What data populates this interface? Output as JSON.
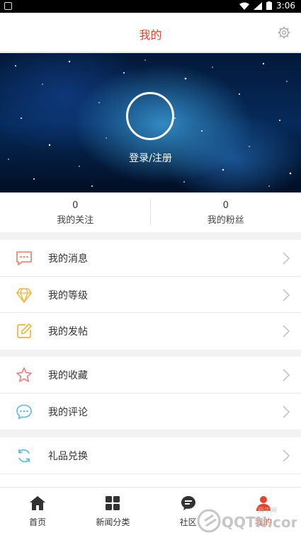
{
  "status_bar": {
    "time": "3:06"
  },
  "header": {
    "title": "我的"
  },
  "profile": {
    "login_label": "登录/注册"
  },
  "stats": [
    {
      "count": "0",
      "label": "我的关注"
    },
    {
      "count": "0",
      "label": "我的粉丝"
    }
  ],
  "menu_groups": [
    [
      {
        "label": "我的消息",
        "icon": "message-icon"
      },
      {
        "label": "我的等级",
        "icon": "diamond-icon"
      },
      {
        "label": "我的发帖",
        "icon": "edit-icon"
      }
    ],
    [
      {
        "label": "我的收藏",
        "icon": "star-icon"
      },
      {
        "label": "我的评论",
        "icon": "comment-icon"
      }
    ],
    [
      {
        "label": "礼品兑换",
        "icon": "exchange-icon"
      }
    ]
  ],
  "tabs": [
    {
      "label": "首页",
      "icon": "home-icon"
    },
    {
      "label": "新闻分类",
      "icon": "grid-icon"
    },
    {
      "label": "社区",
      "icon": "community-icon"
    },
    {
      "label": "我的",
      "icon": "user-icon"
    }
  ],
  "watermark": {
    "text": "QQTN.com",
    "small": "腾牛网"
  },
  "colors": {
    "accent": "#e8402b"
  }
}
